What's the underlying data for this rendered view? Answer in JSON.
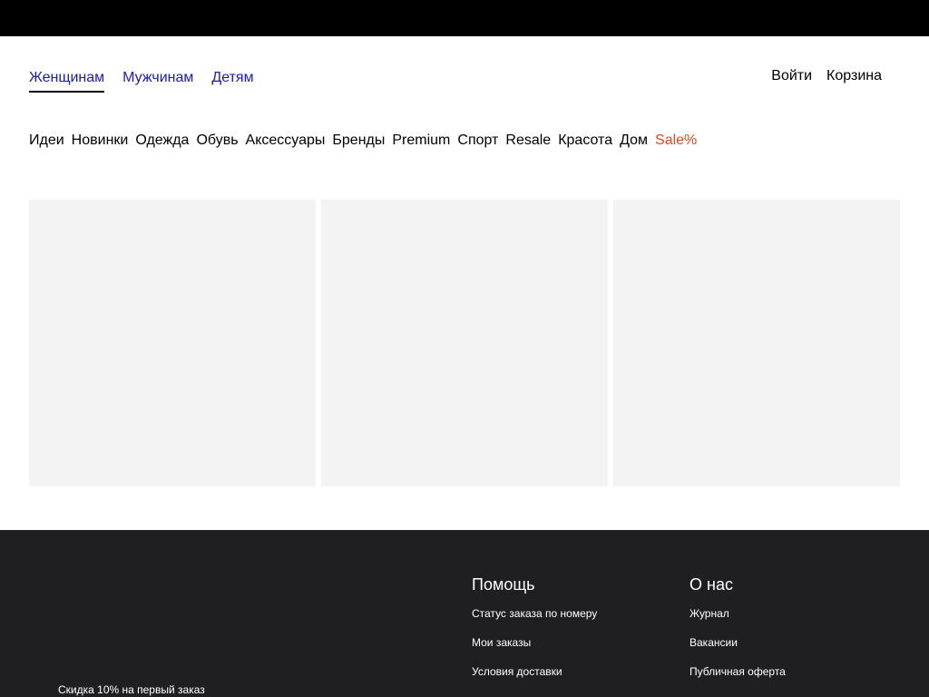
{
  "gender_tabs": [
    "Женщинам",
    "Мужчинам",
    "Детям"
  ],
  "account": {
    "login_label": "Войти",
    "cart_label": "Корзина"
  },
  "categories": [
    "Идеи",
    "Новинки",
    "Одежда",
    "Обувь",
    "Аксессуары",
    "Бренды",
    "Premium",
    "Спорт",
    "Resale",
    "Красота",
    "Дом",
    "Sale%"
  ],
  "footer": {
    "promo": "Скидка 10% на первый заказ",
    "help": {
      "heading": "Помощь",
      "links": [
        "Статус заказа по номеру",
        "Мои заказы",
        "Условия доставки"
      ]
    },
    "about": {
      "heading": "О нас",
      "links": [
        "Журнал",
        "Вакансии",
        "Публичная оферта"
      ]
    }
  },
  "colors": {
    "top_bar": "#000000",
    "tab_link": "#1a1acd",
    "sale": "#e84a18",
    "card_placeholder": "#f3f3f3",
    "footer_bg": "#1f1f21"
  }
}
